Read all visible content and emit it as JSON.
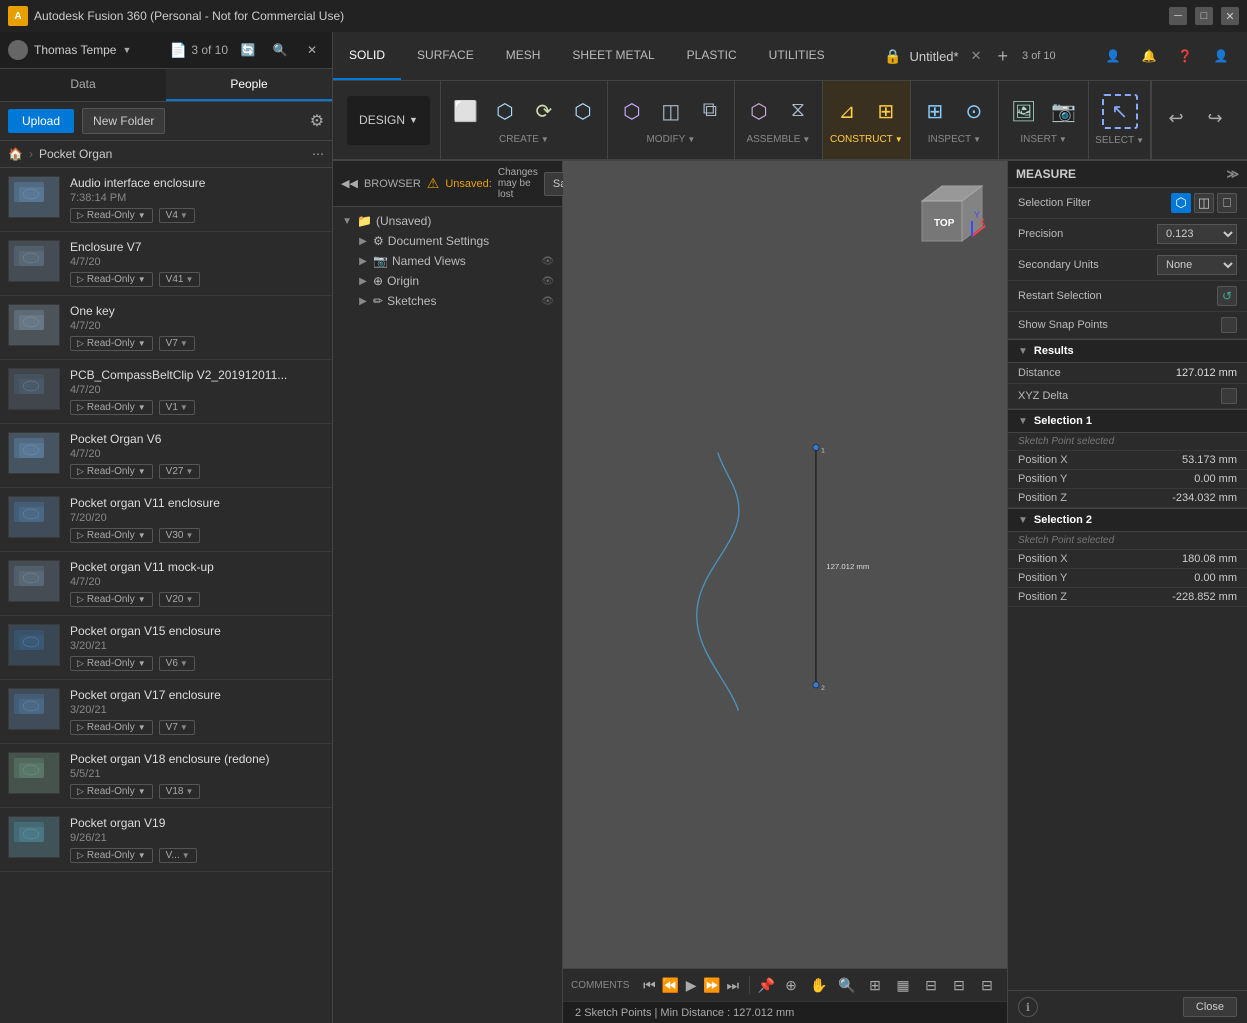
{
  "titlebar": {
    "app_name": "Autodesk Fusion 360 (Personal - Not for Commercial Use)",
    "min_btn": "─",
    "max_btn": "□",
    "close_btn": "✕"
  },
  "left_panel": {
    "user_name": "Thomas Tempe",
    "doc_counter": "3 of 10",
    "tab_data": "Data",
    "tab_people": "People",
    "upload_label": "Upload",
    "new_folder_label": "New Folder",
    "breadcrumb_home": "🏠",
    "breadcrumb_folder": "Pocket Organ",
    "files": [
      {
        "name": "Audio interface enclosure",
        "date": "7:38:14 PM",
        "version": "V4",
        "thumb_color": "#5a7a9a"
      },
      {
        "name": "Enclosure V7",
        "date": "4/7/20",
        "version": "V41",
        "thumb_color": "#5a6a7a"
      },
      {
        "name": "One key",
        "date": "4/7/20",
        "version": "V7",
        "thumb_color": "#6a7a8a"
      },
      {
        "name": "PCB_CompassBeltClip V2_201912011...",
        "date": "4/7/20",
        "version": "V1",
        "thumb_color": "#4a5a6a"
      },
      {
        "name": "Pocket Organ V6",
        "date": "4/7/20",
        "version": "V27",
        "thumb_color": "#5a7a9a"
      },
      {
        "name": "Pocket organ V11 enclosure",
        "date": "7/20/20",
        "version": "V30",
        "thumb_color": "#4a6a8a"
      },
      {
        "name": "Pocket organ V11 mock-up",
        "date": "4/7/20",
        "version": "V20",
        "thumb_color": "#5a6a7a"
      },
      {
        "name": "Pocket organ V15 enclosure",
        "date": "3/20/21",
        "version": "V6",
        "thumb_color": "#3a5a7a"
      },
      {
        "name": "Pocket organ V17 enclosure",
        "date": "3/20/21",
        "version": "V7",
        "thumb_color": "#4a6a8a"
      },
      {
        "name": "Pocket organ V18 enclosure (redone)",
        "date": "5/5/21",
        "version": "V18",
        "thumb_color": "#5a7a6a"
      },
      {
        "name": "Pocket organ V19",
        "date": "9/26/21",
        "version": "V...",
        "thumb_color": "#4a7a8a"
      }
    ],
    "readonly_label": "Read-Only"
  },
  "toolbar": {
    "doc_title": "Untitled*",
    "doc_counter": "3 of 10",
    "tabs": [
      {
        "label": "SOLID",
        "active": true
      },
      {
        "label": "SURFACE",
        "active": false
      },
      {
        "label": "MESH",
        "active": false
      },
      {
        "label": "SHEET METAL",
        "active": false
      },
      {
        "label": "PLASTIC",
        "active": false
      },
      {
        "label": "UTILITIES",
        "active": false
      }
    ],
    "design_label": "DESIGN",
    "create_label": "CREATE",
    "modify_label": "MODIFY",
    "assemble_label": "ASSEMBLE",
    "construct_label": "CONSTRUCT",
    "inspect_label": "INSPECT",
    "insert_label": "INSERT",
    "select_label": "SELECT"
  },
  "browser": {
    "title": "BROWSER",
    "unsaved_text": "Unsaved:",
    "changes_text": "Changes may be lost",
    "save_label": "Save",
    "tree_items": [
      {
        "label": "(Unsaved)",
        "level": 0,
        "has_arrow": true,
        "arrow_dir": "down"
      },
      {
        "label": "Document Settings",
        "level": 1,
        "has_arrow": true,
        "arrow_dir": "right"
      },
      {
        "label": "Named Views",
        "level": 1,
        "has_arrow": true,
        "arrow_dir": "right"
      },
      {
        "label": "Origin",
        "level": 1,
        "has_arrow": true,
        "arrow_dir": "right"
      },
      {
        "label": "Sketches",
        "level": 1,
        "has_arrow": true,
        "arrow_dir": "right"
      }
    ]
  },
  "canvas": {
    "measurement_label": "127.012 mm",
    "point1_label": "1",
    "point2_label": "2",
    "status_bar": "2 Sketch Points | Min Distance : 127.012 mm"
  },
  "measure_panel": {
    "title": "MEASURE",
    "selection_filter_label": "Selection Filter",
    "precision_label": "Precision",
    "precision_value": "0.123",
    "secondary_units_label": "Secondary Units",
    "secondary_units_value": "None",
    "restart_label": "Restart Selection",
    "snap_points_label": "Show Snap Points",
    "results_label": "Results",
    "distance_label": "Distance",
    "distance_value": "127.012 mm",
    "xyz_delta_label": "XYZ Delta",
    "selection1_label": "Selection 1",
    "selection1_subtitle": "Sketch Point selected",
    "pos_x1_label": "Position X",
    "pos_x1_value": "53.173 mm",
    "pos_y1_label": "Position Y",
    "pos_y1_value": "0.00 mm",
    "pos_z1_label": "Position Z",
    "pos_z1_value": "-234.032 mm",
    "selection2_label": "Selection 2",
    "selection2_subtitle": "Sketch Point selected",
    "pos_x2_label": "Position X",
    "pos_x2_value": "180.08 mm",
    "pos_y2_label": "Position Y",
    "pos_y2_value": "0.00 mm",
    "pos_z2_label": "Position Z",
    "pos_z2_value": "-228.852 mm",
    "close_label": "Close"
  },
  "playback": {
    "btns": [
      "⏮",
      "⏪",
      "▶",
      "⏩",
      "⏭"
    ],
    "comments_label": "COMMENTS"
  },
  "colors": {
    "accent": "#0078d7",
    "warning": "#ffd700",
    "bg_dark": "#1e1e1e",
    "bg_mid": "#2b2b2b",
    "bg_light": "#3c3c3c"
  }
}
